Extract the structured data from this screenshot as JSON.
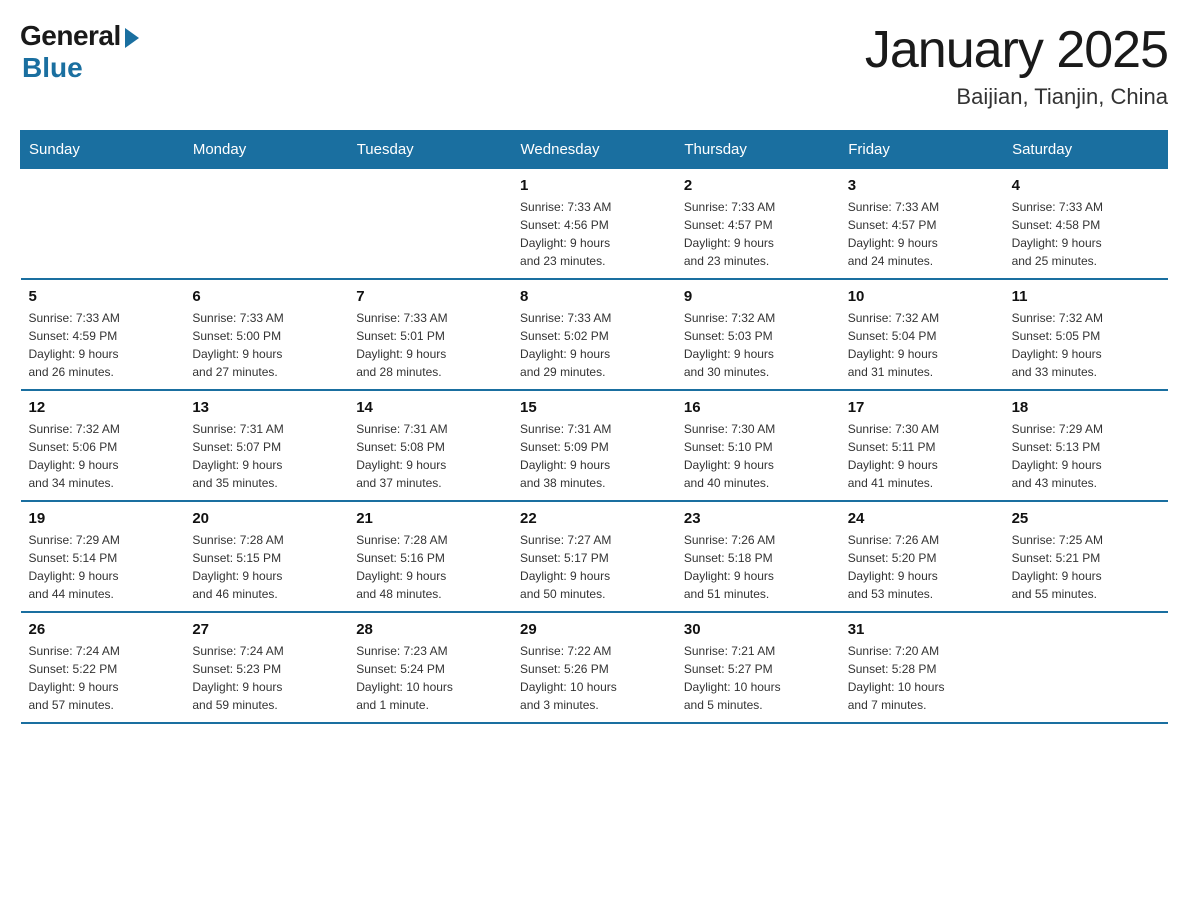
{
  "header": {
    "logo_general": "General",
    "logo_blue": "Blue",
    "title": "January 2025",
    "subtitle": "Baijian, Tianjin, China"
  },
  "days_of_week": [
    "Sunday",
    "Monday",
    "Tuesday",
    "Wednesday",
    "Thursday",
    "Friday",
    "Saturday"
  ],
  "weeks": [
    [
      {
        "day": "",
        "info": ""
      },
      {
        "day": "",
        "info": ""
      },
      {
        "day": "",
        "info": ""
      },
      {
        "day": "1",
        "info": "Sunrise: 7:33 AM\nSunset: 4:56 PM\nDaylight: 9 hours\nand 23 minutes."
      },
      {
        "day": "2",
        "info": "Sunrise: 7:33 AM\nSunset: 4:57 PM\nDaylight: 9 hours\nand 23 minutes."
      },
      {
        "day": "3",
        "info": "Sunrise: 7:33 AM\nSunset: 4:57 PM\nDaylight: 9 hours\nand 24 minutes."
      },
      {
        "day": "4",
        "info": "Sunrise: 7:33 AM\nSunset: 4:58 PM\nDaylight: 9 hours\nand 25 minutes."
      }
    ],
    [
      {
        "day": "5",
        "info": "Sunrise: 7:33 AM\nSunset: 4:59 PM\nDaylight: 9 hours\nand 26 minutes."
      },
      {
        "day": "6",
        "info": "Sunrise: 7:33 AM\nSunset: 5:00 PM\nDaylight: 9 hours\nand 27 minutes."
      },
      {
        "day": "7",
        "info": "Sunrise: 7:33 AM\nSunset: 5:01 PM\nDaylight: 9 hours\nand 28 minutes."
      },
      {
        "day": "8",
        "info": "Sunrise: 7:33 AM\nSunset: 5:02 PM\nDaylight: 9 hours\nand 29 minutes."
      },
      {
        "day": "9",
        "info": "Sunrise: 7:32 AM\nSunset: 5:03 PM\nDaylight: 9 hours\nand 30 minutes."
      },
      {
        "day": "10",
        "info": "Sunrise: 7:32 AM\nSunset: 5:04 PM\nDaylight: 9 hours\nand 31 minutes."
      },
      {
        "day": "11",
        "info": "Sunrise: 7:32 AM\nSunset: 5:05 PM\nDaylight: 9 hours\nand 33 minutes."
      }
    ],
    [
      {
        "day": "12",
        "info": "Sunrise: 7:32 AM\nSunset: 5:06 PM\nDaylight: 9 hours\nand 34 minutes."
      },
      {
        "day": "13",
        "info": "Sunrise: 7:31 AM\nSunset: 5:07 PM\nDaylight: 9 hours\nand 35 minutes."
      },
      {
        "day": "14",
        "info": "Sunrise: 7:31 AM\nSunset: 5:08 PM\nDaylight: 9 hours\nand 37 minutes."
      },
      {
        "day": "15",
        "info": "Sunrise: 7:31 AM\nSunset: 5:09 PM\nDaylight: 9 hours\nand 38 minutes."
      },
      {
        "day": "16",
        "info": "Sunrise: 7:30 AM\nSunset: 5:10 PM\nDaylight: 9 hours\nand 40 minutes."
      },
      {
        "day": "17",
        "info": "Sunrise: 7:30 AM\nSunset: 5:11 PM\nDaylight: 9 hours\nand 41 minutes."
      },
      {
        "day": "18",
        "info": "Sunrise: 7:29 AM\nSunset: 5:13 PM\nDaylight: 9 hours\nand 43 minutes."
      }
    ],
    [
      {
        "day": "19",
        "info": "Sunrise: 7:29 AM\nSunset: 5:14 PM\nDaylight: 9 hours\nand 44 minutes."
      },
      {
        "day": "20",
        "info": "Sunrise: 7:28 AM\nSunset: 5:15 PM\nDaylight: 9 hours\nand 46 minutes."
      },
      {
        "day": "21",
        "info": "Sunrise: 7:28 AM\nSunset: 5:16 PM\nDaylight: 9 hours\nand 48 minutes."
      },
      {
        "day": "22",
        "info": "Sunrise: 7:27 AM\nSunset: 5:17 PM\nDaylight: 9 hours\nand 50 minutes."
      },
      {
        "day": "23",
        "info": "Sunrise: 7:26 AM\nSunset: 5:18 PM\nDaylight: 9 hours\nand 51 minutes."
      },
      {
        "day": "24",
        "info": "Sunrise: 7:26 AM\nSunset: 5:20 PM\nDaylight: 9 hours\nand 53 minutes."
      },
      {
        "day": "25",
        "info": "Sunrise: 7:25 AM\nSunset: 5:21 PM\nDaylight: 9 hours\nand 55 minutes."
      }
    ],
    [
      {
        "day": "26",
        "info": "Sunrise: 7:24 AM\nSunset: 5:22 PM\nDaylight: 9 hours\nand 57 minutes."
      },
      {
        "day": "27",
        "info": "Sunrise: 7:24 AM\nSunset: 5:23 PM\nDaylight: 9 hours\nand 59 minutes."
      },
      {
        "day": "28",
        "info": "Sunrise: 7:23 AM\nSunset: 5:24 PM\nDaylight: 10 hours\nand 1 minute."
      },
      {
        "day": "29",
        "info": "Sunrise: 7:22 AM\nSunset: 5:26 PM\nDaylight: 10 hours\nand 3 minutes."
      },
      {
        "day": "30",
        "info": "Sunrise: 7:21 AM\nSunset: 5:27 PM\nDaylight: 10 hours\nand 5 minutes."
      },
      {
        "day": "31",
        "info": "Sunrise: 7:20 AM\nSunset: 5:28 PM\nDaylight: 10 hours\nand 7 minutes."
      },
      {
        "day": "",
        "info": ""
      }
    ]
  ]
}
